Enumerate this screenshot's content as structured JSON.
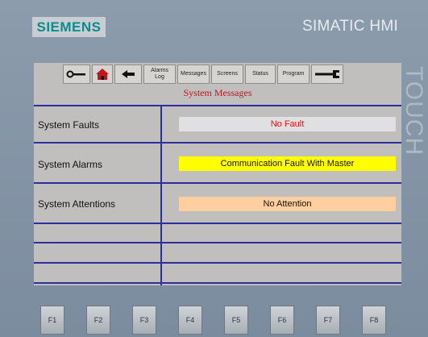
{
  "device": {
    "brand": "SIEMENS",
    "model": "SIMATIC HMI",
    "side_label": "TOUCH"
  },
  "toolbar": {
    "items": [
      {
        "icon": "key-icon"
      },
      {
        "icon": "home-icon"
      },
      {
        "icon": "back-arrow-icon"
      },
      {
        "label": "Alarms\nLog"
      },
      {
        "label": "Messages"
      },
      {
        "label": "Screens"
      },
      {
        "label": "Status"
      },
      {
        "label": "Program"
      },
      {
        "icon": "wrench-icon"
      }
    ]
  },
  "screen": {
    "title": "System Messages",
    "rows": [
      {
        "label": "System Faults",
        "value": "No Fault",
        "value_bg": "#e0e0e2",
        "value_color": "#e0161c"
      },
      {
        "label": "System Alarms",
        "value": "Communication Fault With Master",
        "value_bg": "#ffff00",
        "value_color": "#111111"
      },
      {
        "label": "System Attentions",
        "value": "No Attention",
        "value_bg": "#ffcf9f",
        "value_color": "#111111"
      }
    ]
  },
  "function_keys": [
    "F1",
    "F2",
    "F3",
    "F4",
    "F5",
    "F6",
    "F7",
    "F8"
  ]
}
